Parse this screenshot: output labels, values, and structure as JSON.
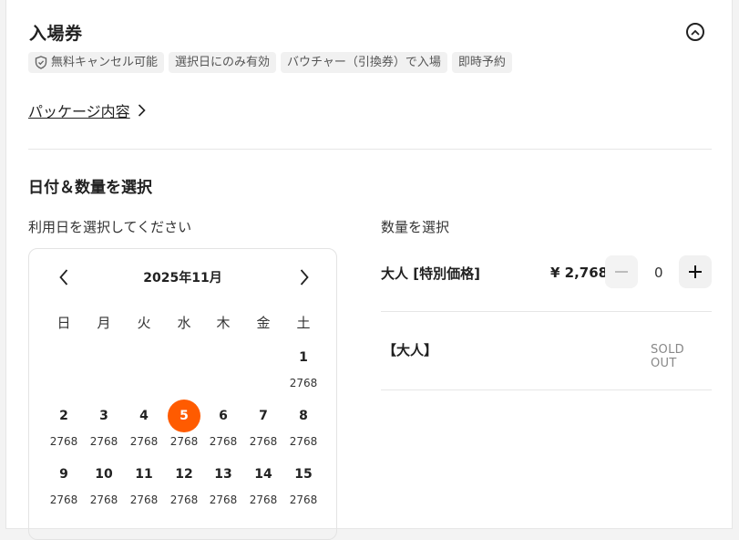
{
  "ticket": {
    "title": "入場券",
    "tags": [
      {
        "icon": "shield-check-icon",
        "label": "無料キャンセル可能"
      },
      {
        "label": "選択日にのみ有効"
      },
      {
        "label": "バウチャー（引換券）で入場"
      },
      {
        "label": "即時予約"
      }
    ],
    "package_link": "パッケージ内容"
  },
  "date_section": {
    "title": "日付＆数量を選択",
    "date_label": "利用日を選択してください",
    "qty_label": "数量を選択"
  },
  "calendar": {
    "month": "2025年11月",
    "weekdays": [
      "日",
      "月",
      "火",
      "水",
      "木",
      "金",
      "土"
    ],
    "weeks": [
      [
        null,
        null,
        null,
        null,
        null,
        null,
        {
          "day": "1",
          "price": "2768"
        }
      ],
      [
        {
          "day": "2",
          "price": "2768"
        },
        {
          "day": "3",
          "price": "2768"
        },
        {
          "day": "4",
          "price": "2768"
        },
        {
          "day": "5",
          "price": "2768",
          "selected": true
        },
        {
          "day": "6",
          "price": "2768"
        },
        {
          "day": "7",
          "price": "2768"
        },
        {
          "day": "8",
          "price": "2768"
        }
      ],
      [
        {
          "day": "9",
          "price": "2768"
        },
        {
          "day": "10",
          "price": "2768"
        },
        {
          "day": "11",
          "price": "2768"
        },
        {
          "day": "12",
          "price": "2768"
        },
        {
          "day": "13",
          "price": "2768"
        },
        {
          "day": "14",
          "price": "2768"
        },
        {
          "day": "15",
          "price": "2768"
        }
      ]
    ],
    "selected_color": "#ff5b00"
  },
  "quantity": {
    "adult_label": "大人 [特別価格]",
    "adult_price": "¥ 2,768",
    "adult_count": "0",
    "adult2_label": "【大人】",
    "adult2_status": "SOLD OUT"
  }
}
